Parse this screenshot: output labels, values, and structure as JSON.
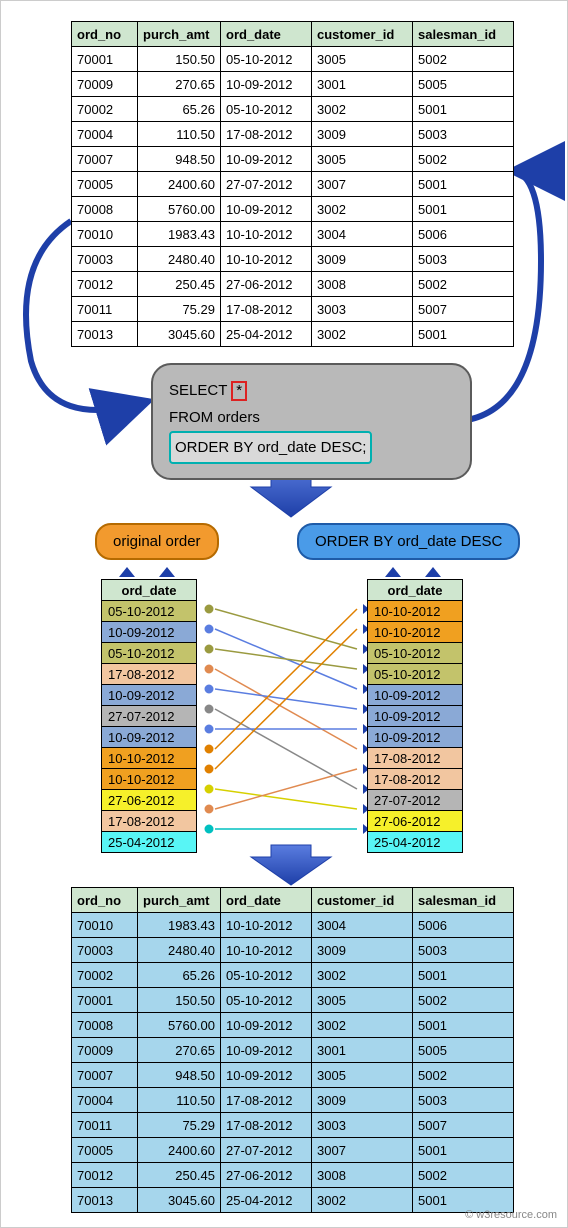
{
  "attribution": "© w3resource.com",
  "top_table": {
    "headers": [
      "ord_no",
      "purch_amt",
      "ord_date",
      "customer_id",
      "salesman_id"
    ],
    "rows": [
      [
        "70001",
        "150.50",
        "05-10-2012",
        "3005",
        "5002"
      ],
      [
        "70009",
        "270.65",
        "10-09-2012",
        "3001",
        "5005"
      ],
      [
        "70002",
        "65.26",
        "05-10-2012",
        "3002",
        "5001"
      ],
      [
        "70004",
        "110.50",
        "17-08-2012",
        "3009",
        "5003"
      ],
      [
        "70007",
        "948.50",
        "10-09-2012",
        "3005",
        "5002"
      ],
      [
        "70005",
        "2400.60",
        "27-07-2012",
        "3007",
        "5001"
      ],
      [
        "70008",
        "5760.00",
        "10-09-2012",
        "3002",
        "5001"
      ],
      [
        "70010",
        "1983.43",
        "10-10-2012",
        "3004",
        "5006"
      ],
      [
        "70003",
        "2480.40",
        "10-10-2012",
        "3009",
        "5003"
      ],
      [
        "70012",
        "250.45",
        "27-06-2012",
        "3008",
        "5002"
      ],
      [
        "70011",
        "75.29",
        "17-08-2012",
        "3003",
        "5007"
      ],
      [
        "70013",
        "3045.60",
        "25-04-2012",
        "3002",
        "5001"
      ]
    ]
  },
  "sql": {
    "select": "SELECT",
    "star": "*",
    "from": "FROM orders",
    "orderby": "ORDER BY ord_date DESC;"
  },
  "badges": {
    "original": "original order",
    "sorted": "ORDER BY ord_date DESC"
  },
  "left_dates": {
    "header": "ord_date",
    "rows": [
      {
        "v": "05-10-2012",
        "c": "clr-olive"
      },
      {
        "v": "10-09-2012",
        "c": "clr-blue1"
      },
      {
        "v": "05-10-2012",
        "c": "clr-olive2"
      },
      {
        "v": "17-08-2012",
        "c": "clr-peach"
      },
      {
        "v": "10-09-2012",
        "c": "clr-blue2"
      },
      {
        "v": "27-07-2012",
        "c": "clr-gray"
      },
      {
        "v": "10-09-2012",
        "c": "clr-blue3"
      },
      {
        "v": "10-10-2012",
        "c": "clr-orange"
      },
      {
        "v": "10-10-2012",
        "c": "clr-orange2"
      },
      {
        "v": "27-06-2012",
        "c": "clr-yellow"
      },
      {
        "v": "17-08-2012",
        "c": "clr-peach2"
      },
      {
        "v": "25-04-2012",
        "c": "clr-cyan"
      }
    ]
  },
  "right_dates": {
    "header": "ord_date",
    "rows": [
      {
        "v": "10-10-2012",
        "c": "clr-orange"
      },
      {
        "v": "10-10-2012",
        "c": "clr-orange2"
      },
      {
        "v": "05-10-2012",
        "c": "clr-olive"
      },
      {
        "v": "05-10-2012",
        "c": "clr-olive2"
      },
      {
        "v": "10-09-2012",
        "c": "clr-blue1"
      },
      {
        "v": "10-09-2012",
        "c": "clr-blue2"
      },
      {
        "v": "10-09-2012",
        "c": "clr-blue3"
      },
      {
        "v": "17-08-2012",
        "c": "clr-peach"
      },
      {
        "v": "17-08-2012",
        "c": "clr-peach2"
      },
      {
        "v": "27-07-2012",
        "c": "clr-gray"
      },
      {
        "v": "27-06-2012",
        "c": "clr-yellow"
      },
      {
        "v": "25-04-2012",
        "c": "clr-cyan"
      }
    ]
  },
  "bottom_table": {
    "headers": [
      "ord_no",
      "purch_amt",
      "ord_date",
      "customer_id",
      "salesman_id"
    ],
    "rows": [
      [
        "70010",
        "1983.43",
        "10-10-2012",
        "3004",
        "5006"
      ],
      [
        "70003",
        "2480.40",
        "10-10-2012",
        "3009",
        "5003"
      ],
      [
        "70002",
        "65.26",
        "05-10-2012",
        "3002",
        "5001"
      ],
      [
        "70001",
        "150.50",
        "05-10-2012",
        "3005",
        "5002"
      ],
      [
        "70008",
        "5760.00",
        "10-09-2012",
        "3002",
        "5001"
      ],
      [
        "70009",
        "270.65",
        "10-09-2012",
        "3001",
        "5005"
      ],
      [
        "70007",
        "948.50",
        "10-09-2012",
        "3005",
        "5002"
      ],
      [
        "70004",
        "110.50",
        "17-08-2012",
        "3009",
        "5003"
      ],
      [
        "70011",
        "75.29",
        "17-08-2012",
        "3003",
        "5007"
      ],
      [
        "70005",
        "2400.60",
        "27-07-2012",
        "3007",
        "5001"
      ],
      [
        "70012",
        "250.45",
        "27-06-2012",
        "3008",
        "5002"
      ],
      [
        "70013",
        "3045.60",
        "25-04-2012",
        "3002",
        "5001"
      ]
    ]
  },
  "chart_data": {
    "type": "table",
    "original_order": [
      "05-10-2012",
      "10-09-2012",
      "05-10-2012",
      "17-08-2012",
      "10-09-2012",
      "27-07-2012",
      "10-09-2012",
      "10-10-2012",
      "10-10-2012",
      "27-06-2012",
      "17-08-2012",
      "25-04-2012"
    ],
    "sorted_order_desc": [
      "10-10-2012",
      "10-10-2012",
      "05-10-2012",
      "05-10-2012",
      "10-09-2012",
      "10-09-2012",
      "10-09-2012",
      "17-08-2012",
      "17-08-2012",
      "27-07-2012",
      "27-06-2012",
      "25-04-2012"
    ],
    "mapping_left_index_to_right_index": [
      2,
      4,
      3,
      7,
      5,
      9,
      6,
      0,
      1,
      10,
      8,
      11
    ]
  }
}
